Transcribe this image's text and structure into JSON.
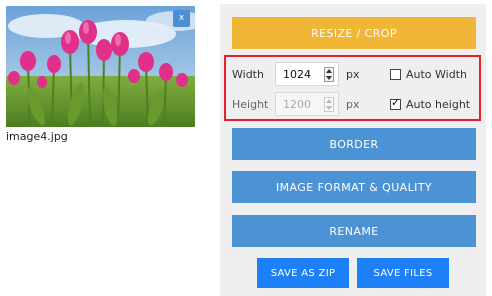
{
  "image": {
    "filename": "image4.jpg",
    "remove_label": "x"
  },
  "actions": {
    "resize_crop": "RESIZE / CROP",
    "border": "BORDER",
    "image_format_quality": "IMAGE FORMAT & QUALITY",
    "rename": "RENAME",
    "save_as_zip": "SAVE AS ZIP",
    "save_files": "SAVE FILES"
  },
  "dimensions": {
    "width_label": "Width",
    "width_value": "1024",
    "height_label": "Height",
    "height_value": "1200",
    "unit": "px",
    "auto_width_label": "Auto Width",
    "auto_width_checked": false,
    "auto_height_label": "Auto height",
    "auto_height_checked": true,
    "tick_glyph": "✓"
  },
  "colors": {
    "resize_button": "#f2b636",
    "action_button": "#4b93d5",
    "save_button": "#1e80f6",
    "highlight": "#e0232b",
    "panel_bg": "#efefef"
  }
}
